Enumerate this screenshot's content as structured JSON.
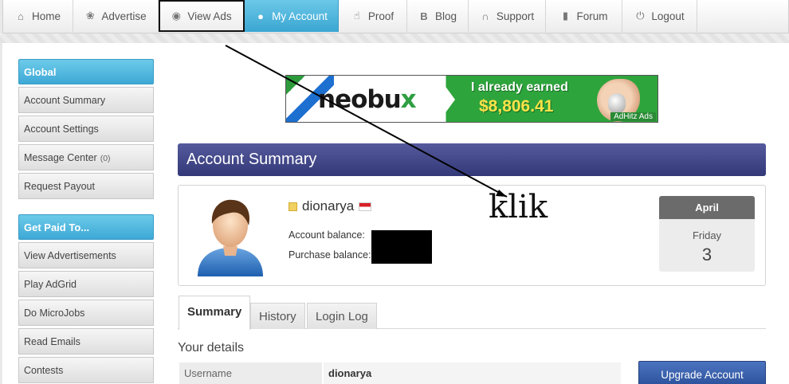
{
  "nav": [
    {
      "label": "Home",
      "icon": "home-icon"
    },
    {
      "label": "Advertise",
      "icon": "leaf-icon"
    },
    {
      "label": "View Ads",
      "icon": "eye-icon"
    },
    {
      "label": "My Account",
      "icon": "user-icon"
    },
    {
      "label": "Proof",
      "icon": "thumbs-up-icon"
    },
    {
      "label": "Blog",
      "icon": "bitcoin-b-icon"
    },
    {
      "label": "Support",
      "icon": "headset-icon"
    },
    {
      "label": "Forum",
      "icon": "speech-bubble-icon"
    },
    {
      "label": "Logout",
      "icon": "power-icon"
    }
  ],
  "sidebar": {
    "global_title": "Global",
    "global_items": [
      {
        "label": "Account Summary"
      },
      {
        "label": "Account Settings"
      },
      {
        "label": "Message Center",
        "count": "(0)"
      },
      {
        "label": "Request Payout"
      }
    ],
    "gpt_title": "Get Paid To...",
    "gpt_items": [
      {
        "label": "View Advertisements"
      },
      {
        "label": "Play AdGrid"
      },
      {
        "label": "Do MicroJobs"
      },
      {
        "label": "Read Emails"
      },
      {
        "label": "Contests"
      }
    ]
  },
  "banner": {
    "logo_main": "neobu",
    "logo_x": "x",
    "earned": "I already earned",
    "amount": "$8,806.41",
    "tag": "AdHitz Ads"
  },
  "summary": {
    "title": "Account Summary",
    "username": "dionarya",
    "account_balance_label": "Account balance:",
    "purchase_balance_label": "Purchase balance:",
    "calendar": {
      "month": "April",
      "weekday": "Friday",
      "day": "3"
    }
  },
  "annotation": {
    "text": "klik"
  },
  "tabs": [
    "Summary",
    "History",
    "Login Log"
  ],
  "details": {
    "title": "Your details",
    "username_label": "Username",
    "username_value": "dionarya",
    "upgrade_label": "Upgrade Account"
  },
  "colors": {
    "nav_active": "#3aa6d2",
    "sidebar_head": "#3ea8d6",
    "summary_header": "#3c4183"
  }
}
